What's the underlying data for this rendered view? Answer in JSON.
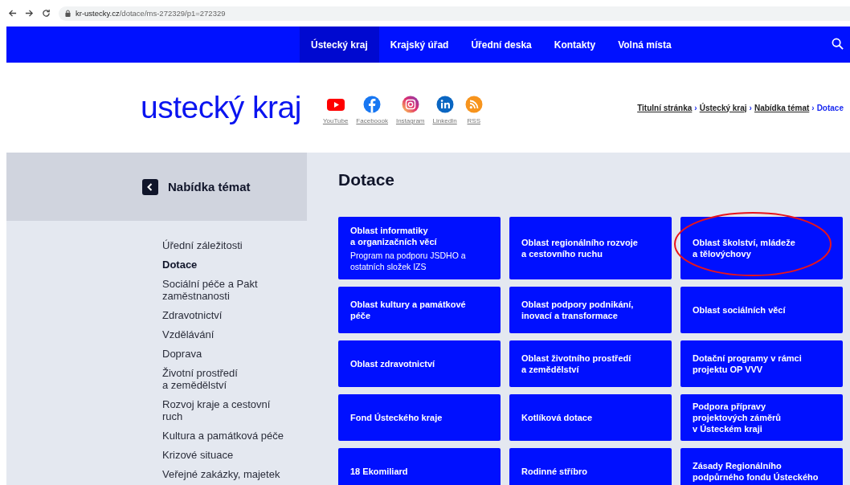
{
  "browser": {
    "url_host": "kr-ustecky.cz",
    "url_path": "/dotace/ms-272329/p1=272329"
  },
  "nav": {
    "items": [
      {
        "label": "Ústecký kraj",
        "selected": true
      },
      {
        "label": "Krajský úřad",
        "selected": false
      },
      {
        "label": "Úřední deska",
        "selected": false
      },
      {
        "label": "Kontakty",
        "selected": false
      },
      {
        "label": "Volná místa",
        "selected": false
      }
    ]
  },
  "header": {
    "logo": "ustecký kraj",
    "social": [
      {
        "kind": "youtube",
        "label": "YouTube"
      },
      {
        "kind": "facebook",
        "label": "Faceboook"
      },
      {
        "kind": "instagram",
        "label": "Instagram"
      },
      {
        "kind": "linkedin",
        "label": "LinkedIn"
      },
      {
        "kind": "rss",
        "label": "RSS"
      }
    ],
    "breadcrumb": {
      "separator": "›",
      "items": [
        {
          "label": "Titulní stránka",
          "current": false
        },
        {
          "label": "Ústecký kraj",
          "current": false
        },
        {
          "label": "Nabídka témat",
          "current": false
        },
        {
          "label": "Dotace",
          "current": true
        }
      ]
    }
  },
  "sidebar": {
    "title": "Nabídka témat",
    "items": [
      {
        "label": "Úřední záležitosti",
        "selected": false
      },
      {
        "label": "Dotace",
        "selected": true
      },
      {
        "label": "Sociální péče a Pakt\nzaměstnanosti",
        "selected": false
      },
      {
        "label": "Zdravotnictví",
        "selected": false
      },
      {
        "label": "Vzdělávání",
        "selected": false
      },
      {
        "label": "Doprava",
        "selected": false
      },
      {
        "label": "Životní prostředí\na zemědělství",
        "selected": false
      },
      {
        "label": "Rozvoj kraje a cestovní\nruch",
        "selected": false
      },
      {
        "label": "Kultura a památková péče",
        "selected": false
      },
      {
        "label": "Krizové situace",
        "selected": false
      },
      {
        "label": "Veřejné zakázky, majetek",
        "selected": false
      }
    ]
  },
  "main": {
    "title": "Dotace",
    "cards": [
      {
        "title": "Oblast informatiky\na organizačních věcí",
        "subtitle": "Program na podporu JSDHO a\nostatních složek IZS",
        "highlighted": false
      },
      {
        "title": "Oblast regionálního rozvoje\na cestovního ruchu",
        "highlighted": false
      },
      {
        "title": "Oblast školství, mládeže\na tělovýchovy",
        "highlighted": true
      },
      {
        "title": "Oblast kultury a památkové\npéče",
        "highlighted": false
      },
      {
        "title": "Oblast podpory podnikání,\ninovací a transformace",
        "highlighted": false
      },
      {
        "title": "Oblast sociálních věcí",
        "highlighted": false
      },
      {
        "title": "Oblast zdravotnictví",
        "highlighted": false
      },
      {
        "title": "Oblast životního prostředí\na zemědělství",
        "highlighted": false
      },
      {
        "title": "Dotační programy v rámci\nprojektu OP VVV",
        "highlighted": false
      },
      {
        "title": "Fond Ústeckého kraje",
        "highlighted": false
      },
      {
        "title": "Kotlíková dotace",
        "highlighted": false
      },
      {
        "title": "Podpora přípravy\nprojektových záměrů\nv Ústeckém kraji",
        "highlighted": false
      },
      {
        "title": "18 Ekomiliard",
        "highlighted": false
      },
      {
        "title": "Rodinné stříbro",
        "highlighted": false
      },
      {
        "title": "Zásady Regionálního\npodpůrného fondu Ústeckého",
        "highlighted": false
      }
    ]
  }
}
